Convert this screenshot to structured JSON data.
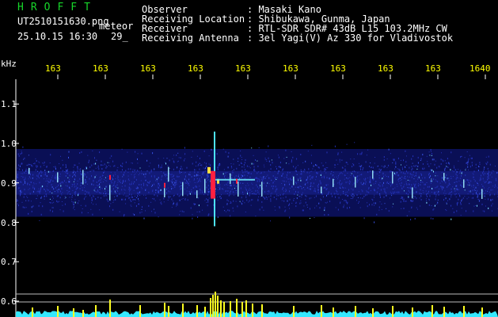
{
  "app": {
    "title": "HROFFT",
    "filename": "UT2510151630.png",
    "mode": "meteor",
    "datetime": "25.10.15 16:30",
    "count": "29",
    "count_suffix": "_"
  },
  "station": {
    "labels": [
      "Observer",
      "Receiving Location",
      "Receiver",
      "Receiving Antenna"
    ],
    "values": [
      ": Masaki Kano",
      ": Shibukawa, Gunma, Japan",
      ": RTL-SDR SDR# 43dB L15 103.2MHz CW",
      ": 3el Yagi(V) Az 330 for Vladivostok"
    ]
  },
  "chart_data": {
    "type": "heatmap",
    "x_unit_label": "kHz",
    "x_ticks": [
      "163",
      "163",
      "163",
      "163",
      "163",
      "163",
      "163",
      "163",
      "163",
      "1640"
    ],
    "y_ticks": [
      "1.1",
      "1.0",
      "0.9",
      "0.8",
      "0.7",
      "0.6"
    ],
    "y_ticks_values": [
      1.1,
      1.0,
      0.9,
      0.8,
      0.7,
      0.6
    ],
    "band_center": 0.9,
    "colors": {
      "background": "#000000",
      "band": "#1f2aa0",
      "echo": "#ff2040",
      "trace": "#35e8ff",
      "spikes": "#ffff20",
      "text": "#ffffff",
      "title": "#17d62a",
      "ticks": "#ffff00"
    }
  }
}
